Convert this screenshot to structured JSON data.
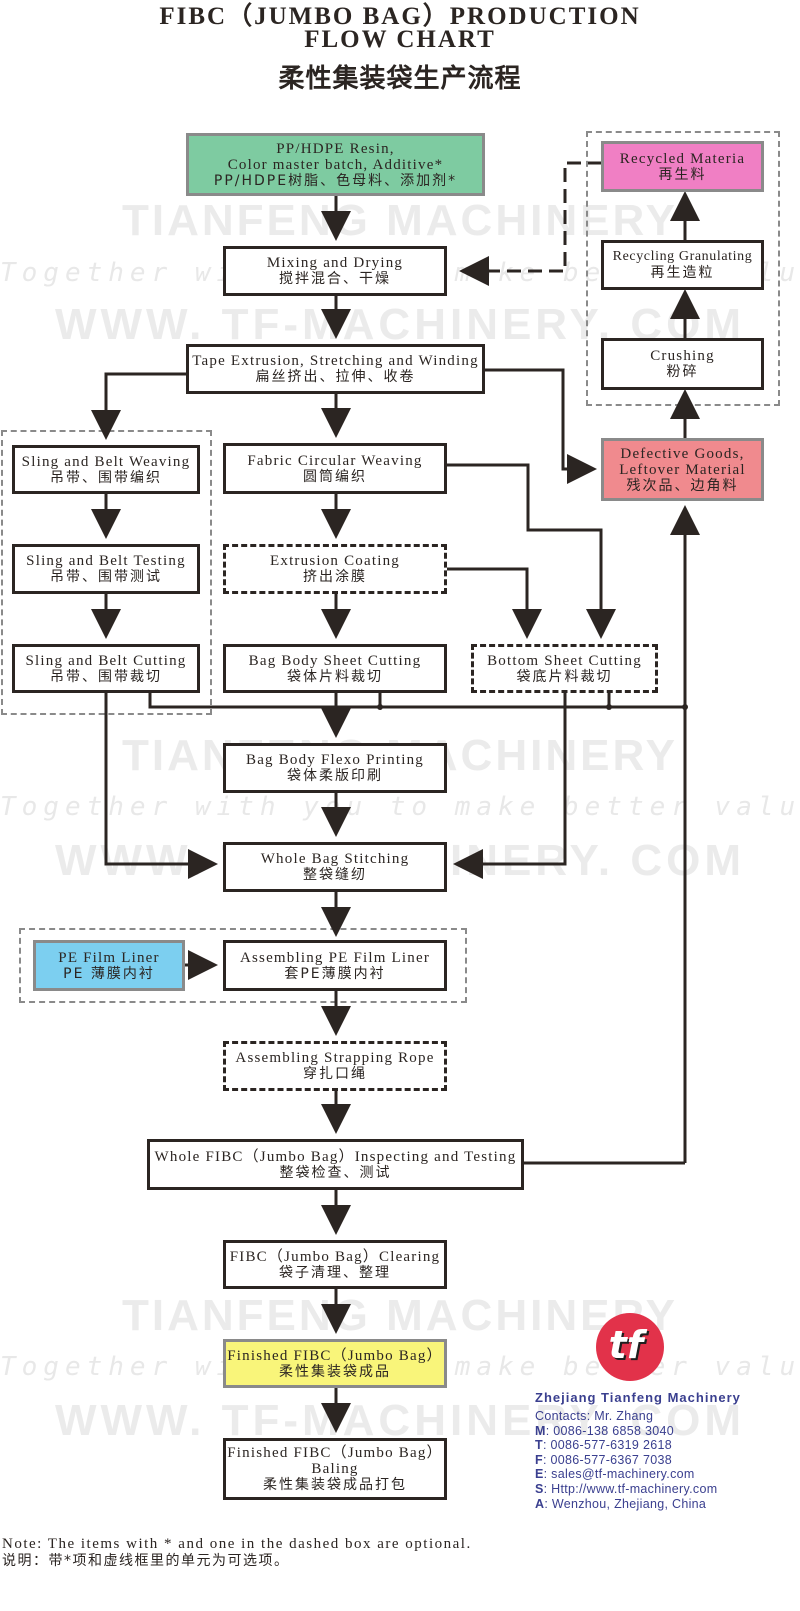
{
  "title": {
    "line1": "FIBC（JUMBO BAG）PRODUCTION",
    "line2": "FLOW CHART",
    "line3": "柔性集装袋生产流程"
  },
  "watermark": {
    "brand": "TIANFENG MACHINERY",
    "slogan": "Together with you to make better value!",
    "url": "WWW. TF-MACHINERY. COM"
  },
  "nodes": {
    "resin": {
      "en1": "PP/HDPE Resin,",
      "en2": "Color master batch, Additive*",
      "zh": "PP/HDPE树脂、色母料、添加剂*",
      "fill": "#7ecba1"
    },
    "mixing": {
      "en": "Mixing and Drying",
      "zh": "搅拌混合、干燥"
    },
    "tape": {
      "en": "Tape Extrusion, Stretching and Winding",
      "zh": "扁丝挤出、拉伸、收卷"
    },
    "sling_weaving": {
      "en": "Sling and Belt Weaving",
      "zh": "吊带、围带编织"
    },
    "sling_testing": {
      "en": "Sling and Belt Testing",
      "zh": "吊带、围带测试"
    },
    "sling_cutting": {
      "en": "Sling and Belt Cutting",
      "zh": "吊带、围带裁切"
    },
    "fabric_weaving": {
      "en": "Fabric Circular Weaving",
      "zh": "圆筒编织"
    },
    "extrusion_coating": {
      "en": "Extrusion Coating",
      "zh": "挤出涂膜"
    },
    "body_cutting": {
      "en": "Bag Body Sheet Cutting",
      "zh": "袋体片料裁切"
    },
    "bottom_cutting": {
      "en": "Bottom Sheet Cutting",
      "zh": "袋底片料裁切"
    },
    "flexo": {
      "en": "Bag Body Flexo Printing",
      "zh": "袋体柔版印刷"
    },
    "stitching": {
      "en": "Whole Bag Stitching",
      "zh": "整袋缝纫"
    },
    "pe_liner": {
      "en": "PE Film Liner",
      "zh": "PE 薄膜内衬",
      "fill": "#7ccff0"
    },
    "assembling_liner": {
      "en": "Assembling PE Film Liner",
      "zh": "套PE薄膜内衬"
    },
    "strapping": {
      "en": "Assembling Strapping Rope",
      "zh": "穿扎口绳"
    },
    "inspecting": {
      "en": "Whole FIBC（Jumbo Bag）Inspecting and Testing",
      "zh": "整袋检查、测试"
    },
    "clearing": {
      "en": "FIBC（Jumbo Bag）Clearing",
      "zh": "袋子清理、整理"
    },
    "finished": {
      "en": "Finished FIBC（Jumbo Bag）",
      "zh": "柔性集装袋成品",
      "fill": "#f9f57a"
    },
    "baling": {
      "en1": "Finished FIBC（Jumbo Bag）",
      "en2": "Baling",
      "zh": "柔性集装袋成品打包"
    },
    "recycled": {
      "en": "Recycled Materia",
      "zh": "再生料",
      "fill": "#f07fc4"
    },
    "granulating": {
      "en": "Recycling Granulating",
      "zh": "再生造粒"
    },
    "crushing": {
      "en": "Crushing",
      "zh": "粉碎"
    },
    "defective": {
      "en1": "Defective Goods,",
      "en2": "Leftover Material",
      "zh": "残次品、边角料",
      "fill": "#f08a8e"
    }
  },
  "note": {
    "en": "Note: The items with * and one in the dashed box are optional.",
    "zh": "说明：带*项和虚线框里的单元为可选项。"
  },
  "contact": {
    "company": "Zhejiang Tianfeng Machinery",
    "contacts": "Contacts: Mr. Zhang",
    "lines": [
      {
        "key": "M",
        "value": ": 0086-138 6858 3040"
      },
      {
        "key": "T",
        "value": ": 0086-577-6319 2618"
      },
      {
        "key": "F",
        "value": ": 0086-577-6367 7038"
      },
      {
        "key": "E",
        "value": ": sales@tf-machinery.com"
      },
      {
        "key": "S",
        "value": ": Http://www.tf-machinery.com"
      },
      {
        "key": "A",
        "value": ": Wenzhou, Zhejiang, China"
      }
    ],
    "logo_text": "tf",
    "logo_color": "#e2324a",
    "text_color": "#3a3f8f"
  },
  "colors": {
    "line": "#2b2522",
    "group_border": "#8a8a8a"
  }
}
